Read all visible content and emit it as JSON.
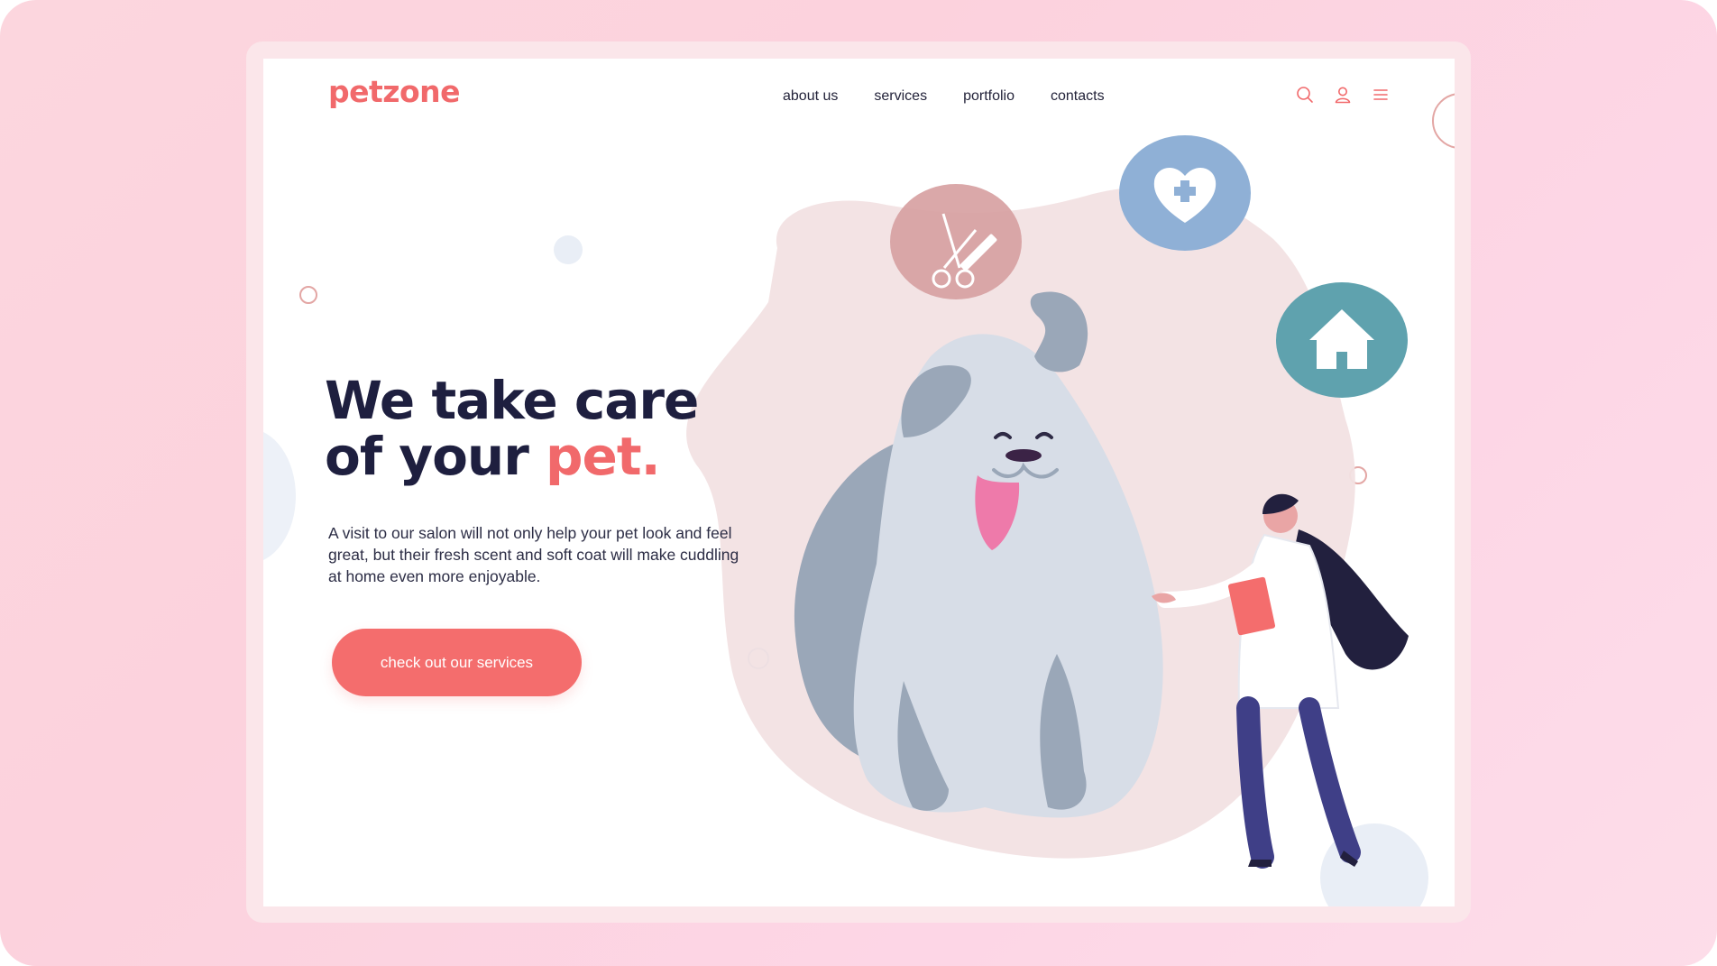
{
  "brand": {
    "logo_text": "petzone",
    "accent_color": "#f1696b",
    "dark_color": "#1e1f3f"
  },
  "nav": {
    "items": [
      "about us",
      "services",
      "portfolio",
      "contacts"
    ]
  },
  "header_icons": [
    "search-icon",
    "user-icon",
    "menu-icon"
  ],
  "hero": {
    "title_line1": "We take care",
    "title_line2_prefix": "of your ",
    "title_accent": "pet.",
    "description": "A visit to our salon will not only help your pet look and feel great, but their fresh scent and soft coat will make cuddling at home even more enjoyable.",
    "cta_label": "check out our services"
  },
  "illustration": {
    "badges": [
      "grooming-scissors-comb-icon",
      "heart-plus-icon",
      "house-icon"
    ],
    "characters": [
      "dog",
      "veterinarian-woman"
    ]
  }
}
